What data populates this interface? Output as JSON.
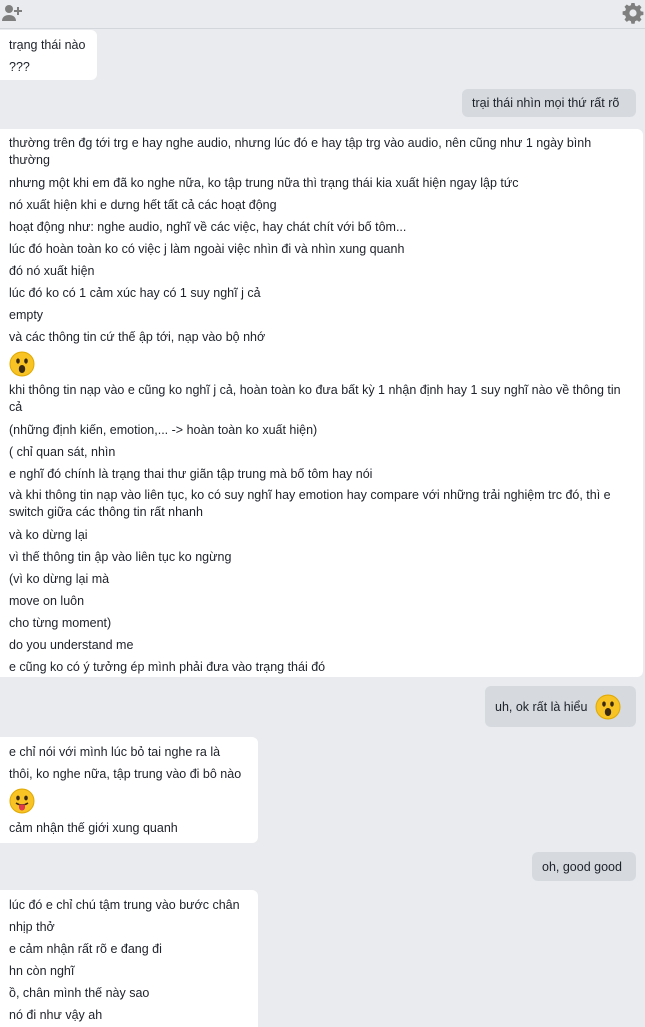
{
  "toolbar": {
    "left_icon": "add-contact-icon",
    "right_icon": "gear-icon"
  },
  "messages": [
    {
      "side": "in",
      "lines": [
        "trạng thái nào",
        "???"
      ]
    },
    {
      "side": "out",
      "text": "trại thái nhìn mọi thứ rất rõ"
    },
    {
      "side": "in",
      "lines": [
        "thường trên đg tới trg e hay nghe audio, nhưng lúc đó e hay tập trg vào audio, nên cũng như 1 ngày bình thường",
        "nhưng một khi em đã ko nghe nữa, ko tập trung nữa thì trạng thái kia xuất hiện ngay lập tức",
        "nó xuất hiện khi e dưng hết tất cả các hoạt động",
        "hoạt động như: nghe audio, nghĩ về các việc, hay chát chít với bố tôm...",
        "lúc đó hoàn toàn ko có việc j làm ngoài việc nhìn đi và nhìn xung quanh",
        "đó nó xuất hiện",
        "lúc đó ko có 1 cảm xúc hay có 1  suy nghĩ j cả",
        "empty",
        "và các thông tin cứ thế ập tới, nạp vào bộ nhớ",
        "khi thông tin nạp vào e cũng ko nghĩ j cả, hoàn toàn ko đưa bất kỳ 1 nhận định hay 1 suy nghĩ nào về thông tin cả",
        "(những định kiến, emotion,... -> hoàn toàn ko xuất hiện)",
        "( chỉ quan sát, nhìn",
        "e nghĩ đó chính là trạng thai thư giãn tập trung mà bố tôm hay nói",
        "và khi thông tin nạp vào liên tục, ko có suy nghĩ hay emotion hay compare với những trải nghiệm trc đó, thì e switch giữa các thông tin rất nhanh",
        "và ko dừng lại",
        "vì thế thông tin ập vào liên tục ko ngừng",
        "(vì ko dừng lại mà",
        "move on luôn",
        "cho từng moment)",
        "do you understand me",
        "e cũng ko có ý tưởng ép mình phải đưa vào trạng thái đó"
      ],
      "emoji_after_line": 8,
      "emoji": "wow-emoji"
    },
    {
      "side": "out",
      "text": "uh, ok rất là hiểu",
      "emoji": "wow-emoji"
    },
    {
      "side": "in",
      "lines": [
        "e chỉ nói với mình lúc bỏ tai nghe ra là",
        "thôi, ko nghe nữa, tập trung vào đi bô nào",
        "cảm nhận thế giới xung quanh"
      ],
      "emoji_after_line": 1,
      "emoji": "tongue-emoji"
    },
    {
      "side": "out",
      "text": "oh, good good"
    },
    {
      "side": "in",
      "lines": [
        "lúc đó e chỉ chú tậm trung vào bước chân",
        "nhịp thở",
        "e cảm nhận rất rõ e đang đi",
        "hn còn nghĩ",
        "ồ, chân mình thế này sao",
        "nó đi như vậy ah"
      ]
    }
  ]
}
